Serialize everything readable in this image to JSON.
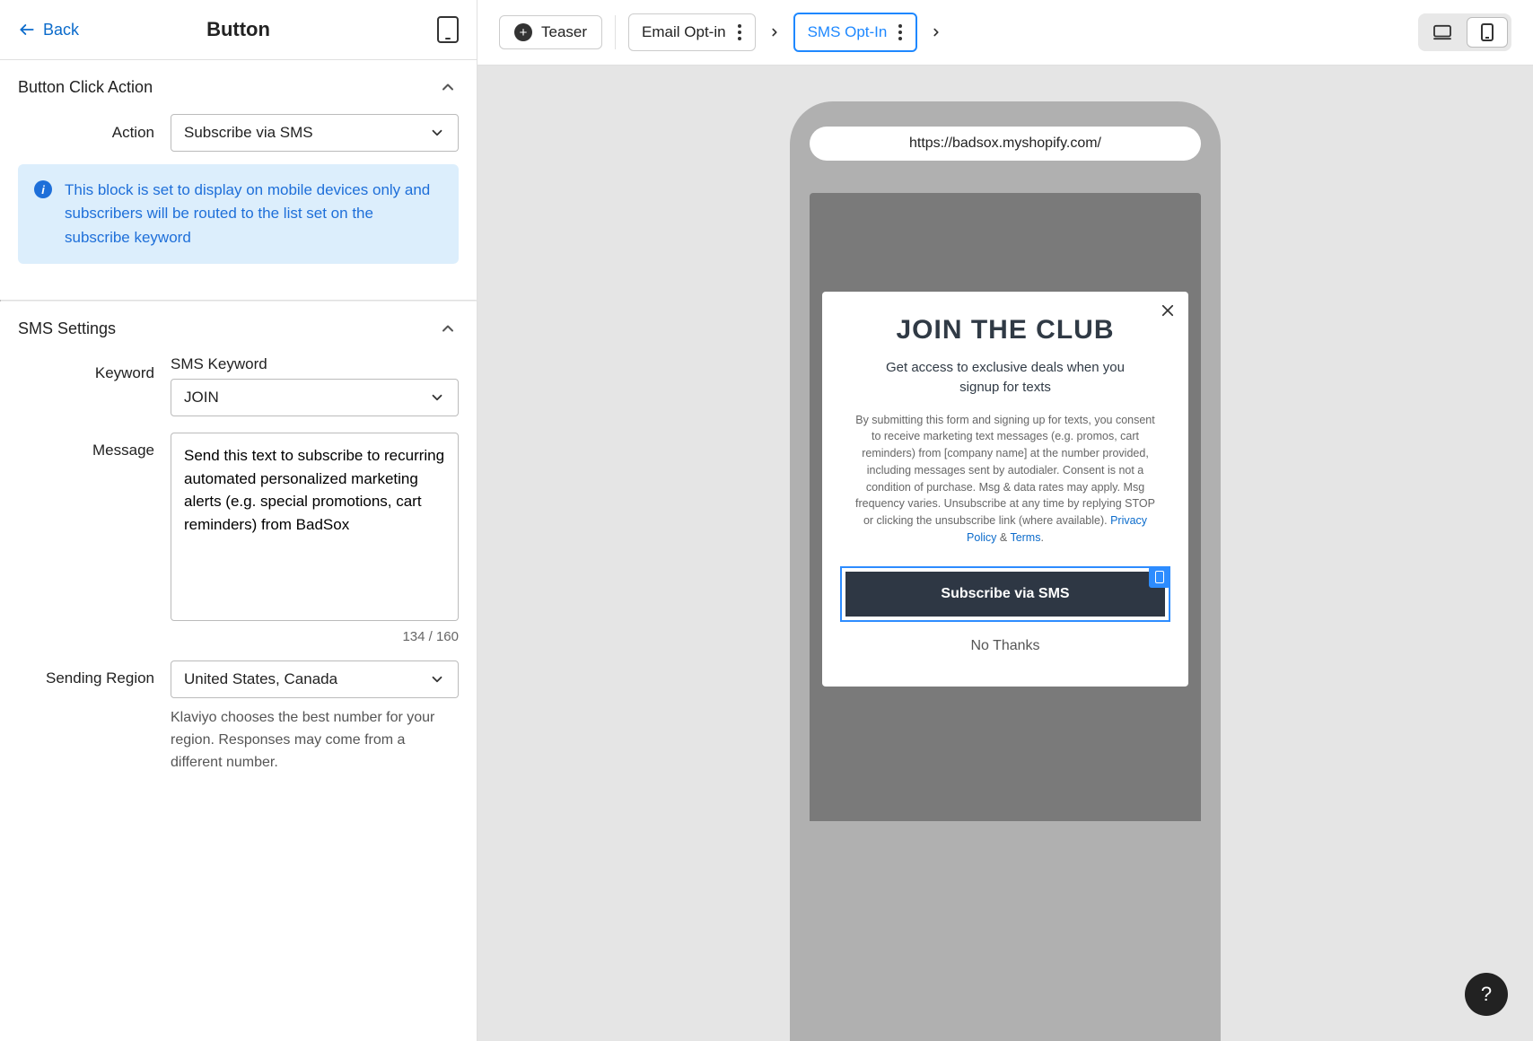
{
  "header": {
    "back_label": "Back",
    "title": "Button"
  },
  "toolbar": {
    "teaser_label": "Teaser",
    "steps": [
      {
        "label": "Email Opt-in",
        "active": false
      },
      {
        "label": "SMS Opt-In",
        "active": true
      }
    ]
  },
  "sections": {
    "click_action": {
      "title": "Button Click Action",
      "action_label": "Action",
      "action_value": "Subscribe via SMS",
      "info_text": "This block is set to display on mobile devices only and subscribers will be routed to the list set on the subscribe keyword"
    },
    "sms_settings": {
      "title": "SMS Settings",
      "keyword_sublabel": "SMS Keyword",
      "keyword_label": "Keyword",
      "keyword_value": "JOIN",
      "message_label": "Message",
      "message_value": "Send this text to subscribe to recurring automated personalized marketing alerts (e.g. special promotions, cart reminders) from BadSox",
      "char_count": "134 / 160",
      "sending_region_label": "Sending Region",
      "sending_region_value": "United States, Canada",
      "sending_region_help": "Klaviyo chooses the best number for your region. Responses may come from a different number."
    }
  },
  "preview": {
    "url": "https://badsox.myshopify.com/",
    "popup": {
      "title": "JOIN THE CLUB",
      "subtitle": "Get access to exclusive deals when you signup for texts",
      "terms_prefix": "By submitting this form and signing up for texts, you consent to receive marketing text messages (e.g. promos, cart reminders) from [company name] at the number provided, including messages sent by autodialer. Consent is not a condition of purchase. Msg & data rates may apply. Msg frequency varies. Unsubscribe at any time by replying STOP or clicking the unsubscribe link (where available). ",
      "privacy_label": "Privacy Policy",
      "amp": " & ",
      "terms_label": "Terms",
      "period": ".",
      "cta_label": "Subscribe via SMS",
      "decline_label": "No Thanks"
    }
  },
  "help_label": "?"
}
